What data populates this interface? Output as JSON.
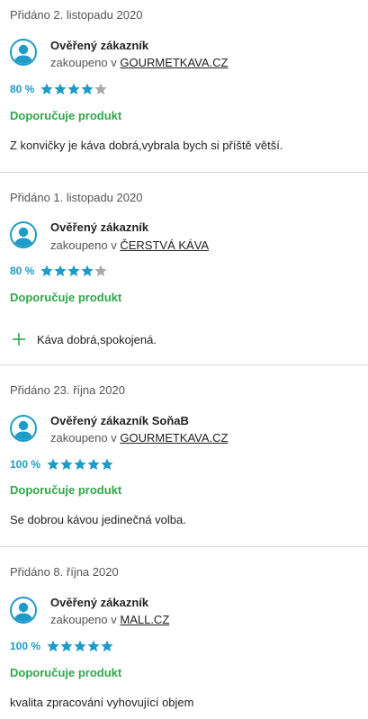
{
  "reviews": [
    {
      "added": "Přidáno 2. listopadu 2020",
      "author": "Ověřený zákazník",
      "purchased_prefix": "zakoupeno v",
      "shop": "GOURMETKAVA.CZ",
      "rating_pct": "80 %",
      "stars": 4,
      "recommend": "Doporučuje produkt",
      "text": "Z konvičky je káva dobrá,vybrala bych si příště větší."
    },
    {
      "added": "Přidáno 1. listopadu 2020",
      "author": "Ověřený zákazník",
      "purchased_prefix": "zakoupeno v",
      "shop": "ČERSTVÁ KÁVA",
      "rating_pct": "80 %",
      "stars": 4,
      "recommend": "Doporučuje produkt",
      "pro": "Káva dobrá,spokojená."
    },
    {
      "added": "Přidáno 23. října 2020",
      "author": "Ověřený zákazník SoňaB",
      "purchased_prefix": "zakoupeno v",
      "shop": "GOURMETKAVA.CZ",
      "rating_pct": "100 %",
      "stars": 5,
      "recommend": "Doporučuje produkt",
      "text": "Se dobrou kávou jedinečná volba."
    },
    {
      "added": "Přidáno 8. října 2020",
      "author": "Ověřený zákazník",
      "purchased_prefix": "zakoupeno v",
      "shop": "MALL.CZ",
      "rating_pct": "100 %",
      "stars": 5,
      "recommend": "Doporučuje produkt",
      "text": "kvalita zpracování vyhovující objem"
    }
  ],
  "colors": {
    "accent": "#1e9bc7",
    "recommend": "#2fa84a",
    "star_empty": "#a9a9a9",
    "divider": "#d6d6d6"
  },
  "icons": {
    "avatar": "user-avatar-icon",
    "star": "star-icon",
    "pro": "plus-icon"
  }
}
